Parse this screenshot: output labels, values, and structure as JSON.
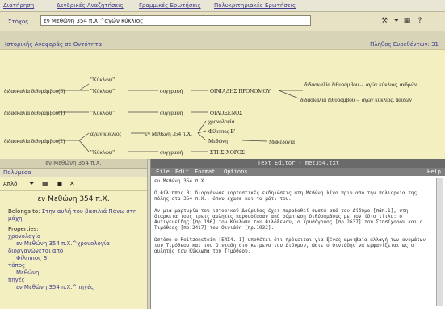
{
  "menu": {
    "items": [
      "Διατήρηση",
      "Δενδρικές Αναζητήσεις",
      "Γραμμικές Ερωτήσεις",
      "Πολυκριτηριακές Ερωτήσεις"
    ]
  },
  "query": {
    "label": "Στόχος",
    "value": "εν Μεθώνη 354 π.Χ.^αγών κύκλιος"
  },
  "history": {
    "label": "Ιστορικής Αναφοράς σε Οντότητα",
    "count_label": "Πλήθος Ευρεθέντων: 31"
  },
  "graph": {
    "left_nodes": [
      "διδασκαλία διθυράμβου(3)",
      "διδασκαλία διθυράμβου(1)",
      "διδασκαλία διθυράμβου(2)"
    ],
    "mid_nodes": [
      "\"Κύκλωψ\"",
      "\"Κύκλωψ\"",
      "\"Κύκλωψ\"",
      "αγών κύκλιος",
      "\"Κύκλωψ\""
    ],
    "verbs": [
      "συγγραφή",
      "συγγραφή",
      "εν Μεθώνη 354 π.Χ.",
      "συγγραφή"
    ],
    "names": [
      "ΟΙΝΙΑΔΗΣ ΠΡΟΝΟΜΟΥ",
      "ΦΙΛΟΞΕΝΟΣ",
      "χρονολογία",
      "Φίλιππος Β'",
      "Μεθώνη",
      "ΣΤΗΣΙΧΟΡΟΣ",
      "Μακεδονία"
    ],
    "right_nodes": [
      "διδασκαλία διθυράμβου→ αγών κύκλιος, ανδρών",
      "διδασκαλία διθυράμβου→ αγών κύκλιος, παίδων"
    ]
  },
  "left_panel": {
    "title": "εν Μεθώνη 354 π.Χ.",
    "subtitle": "Πολυμέσα",
    "toolbar_label": "Απλό",
    "heading": "εν Μεθώνη 354 π.Χ.",
    "belongs_label": "Belongs to:",
    "belongs_value": "Στην αυλή του βασιλιά Πάνω στη μάχη",
    "properties_label": "Properties:",
    "props": [
      {
        "k": "χρονολογία",
        "v": "εν Μεθώνη 354 π.Χ.^χρονολογία"
      },
      {
        "k": "διοργανώνεται από",
        "v": "Φίλιππος Β'"
      },
      {
        "k": "τόπος",
        "v": "Μεθώνη"
      },
      {
        "k": "πηγές",
        "v": "εν Μεθώνη 354 π.Χ.^πηγές"
      }
    ]
  },
  "editor": {
    "title": "Text Editor - met354.txt",
    "menu": [
      "File",
      "Edit",
      "Format",
      "Options"
    ],
    "help": "Help",
    "paragraphs": [
      "εν Μεθώνη 354 π.Χ.",
      "Ο Φίλιππος Β' διοργάνωσε εορταστικές εκδηλώσεις στη Μεθώνη λίγο πριν από την πολιορκία της πόλης στα 354 π.Χ., όπου έχασε και το μάτι του.",
      "Αν μια μαρτυρία του ιστορικού Δούριδος έχει παραδοθεί σωστά από τον Δίδυμο [πάπ.1], στη διάρκεια τους τρεις αυλητές παρουσίασαν από σύμπτωση διθύραμβους με τον ίδιο τίτλο: ο Αντιγενείδης [πρ.196] τον Κύκλωπα του Φιλόξενου, ο Χρυσόγονος [πρ.2637] του Στησίχορου και ο Τιμόθεος [πρ.2417] του Οινιάδη [πρ.1932].",
      "Ωστόσο ο Reitzenstein [Ε4Σ4. 1] υποθέτει ότι πρόκειται για ξένες αμοιβαία αλλαγή των ονομάτων του Τιμόθεου και του Οινιάδη στο κείμενο του Διδύμου, ώστε ο Οινιάδης να εμφανίζεται ως ο αυλητής του Κύκλωπα του Τιμόθεου."
    ]
  }
}
